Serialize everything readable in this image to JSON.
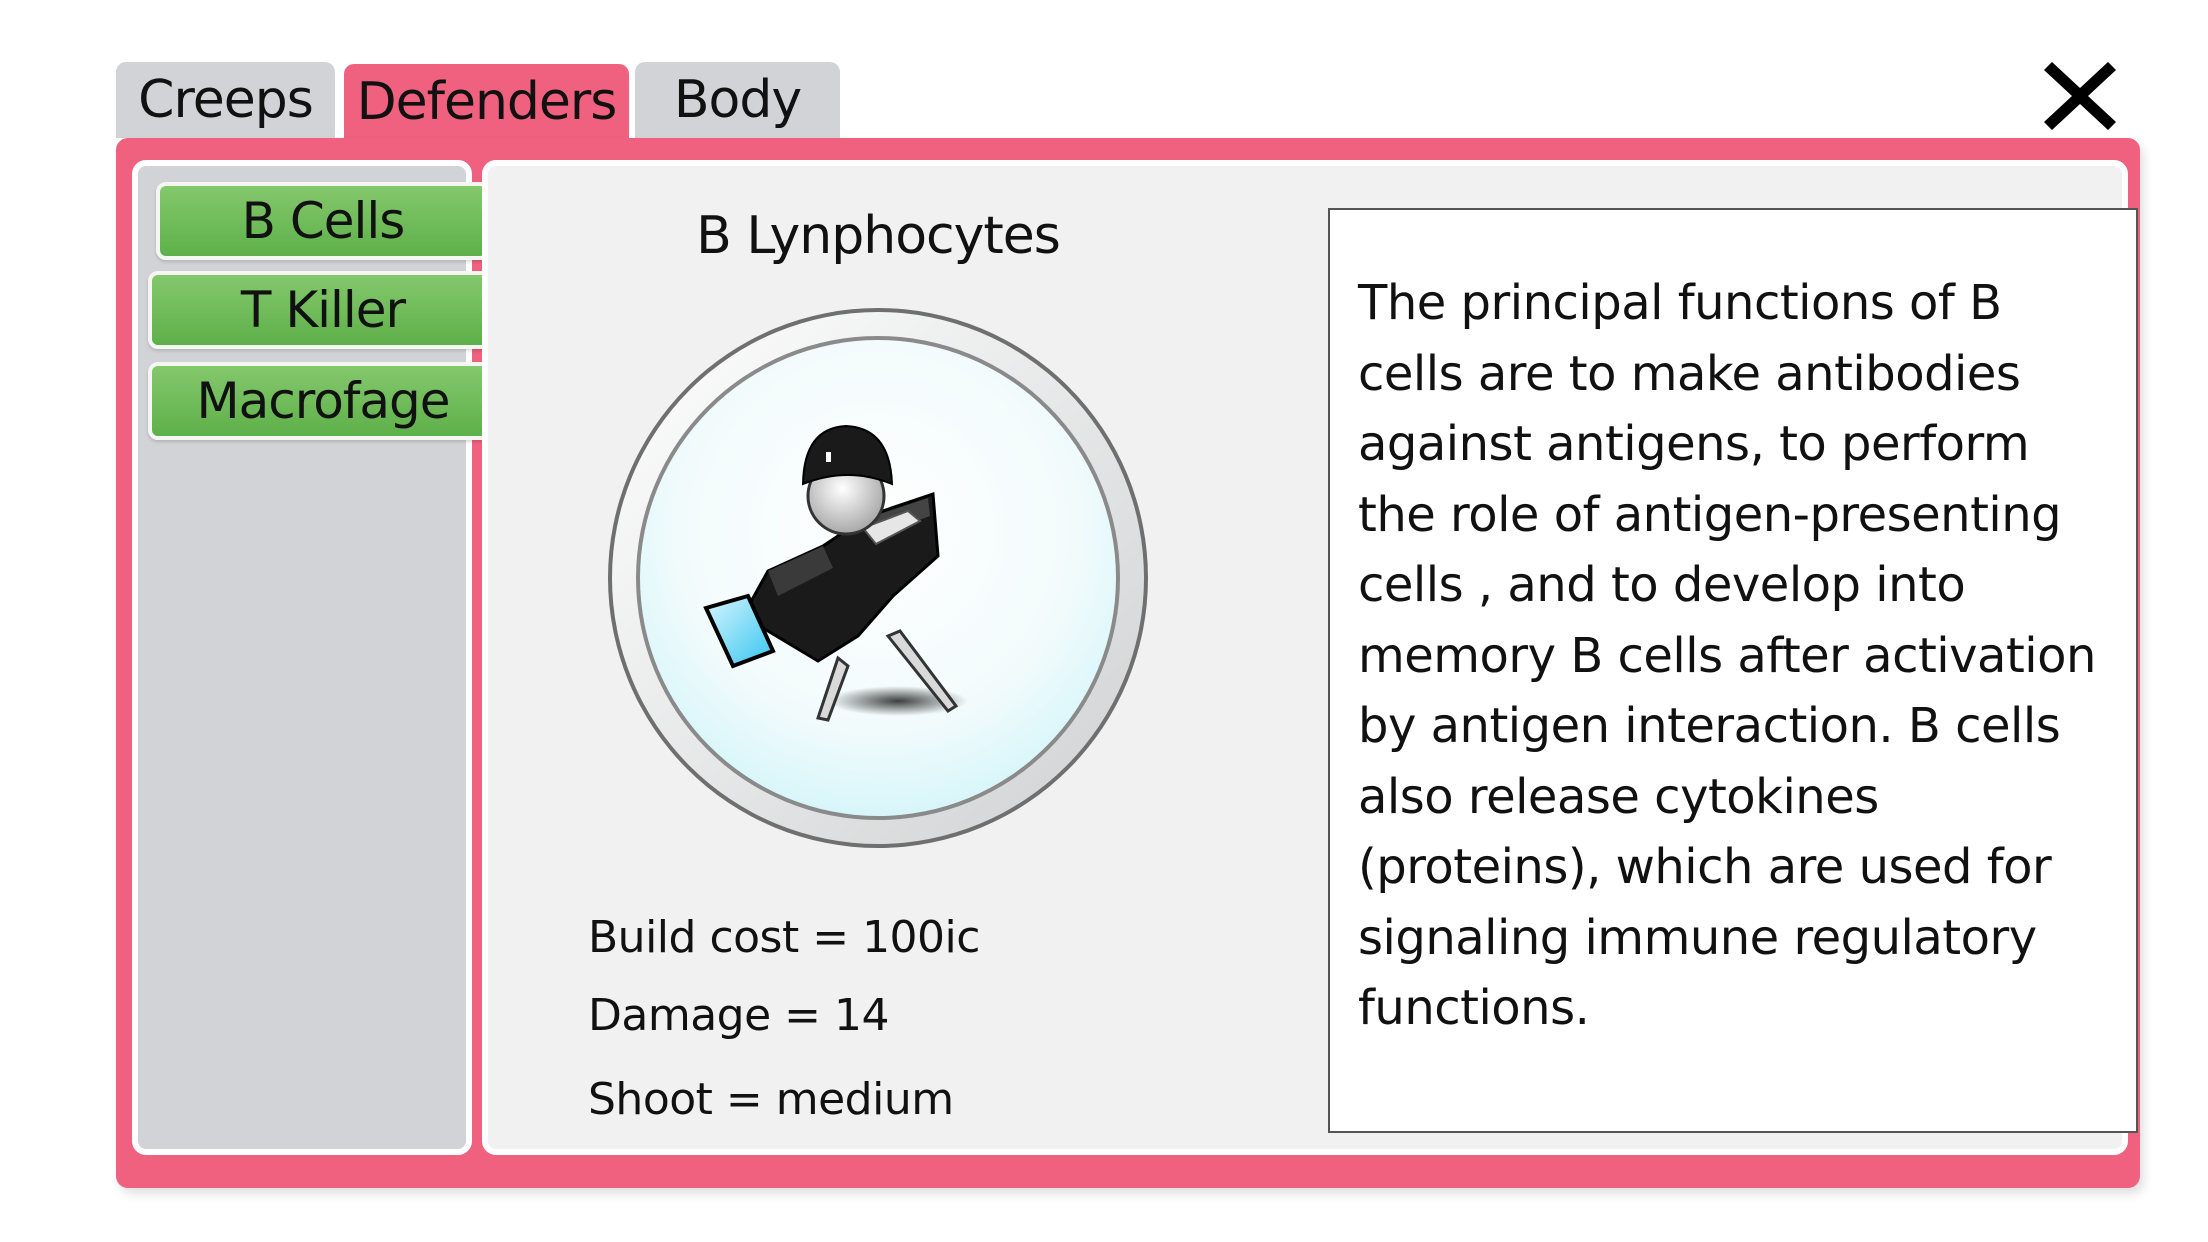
{
  "tabs": {
    "creeps": "Creeps",
    "defenders": "Defenders",
    "body": "Body"
  },
  "active_tab": "Defenders",
  "sidebar": {
    "items": [
      {
        "label": "B Cells"
      },
      {
        "label": "T Killer"
      },
      {
        "label": "Macrofage"
      }
    ]
  },
  "unit": {
    "title": "B Lynphocytes",
    "portrait_icon": "b-cell-turret-icon",
    "stats": {
      "build_cost": "Build cost = 100ic",
      "damage": "Damage = 14",
      "shoot": "Shoot = medium"
    },
    "description": "The principal functions of B cells are to make antibodies against antigens, to perform the role of antigen-presenting cells , and to develop into memory B cells after activation by antigen interaction. B cells also release cytokines (proteins), which are used for signaling immune regulatory functions."
  },
  "colors": {
    "accent_pink": "#f0607f",
    "tab_inactive": "#d2d3d6",
    "button_green": "#6cbb56",
    "content_bg": "#f0f1f0"
  }
}
